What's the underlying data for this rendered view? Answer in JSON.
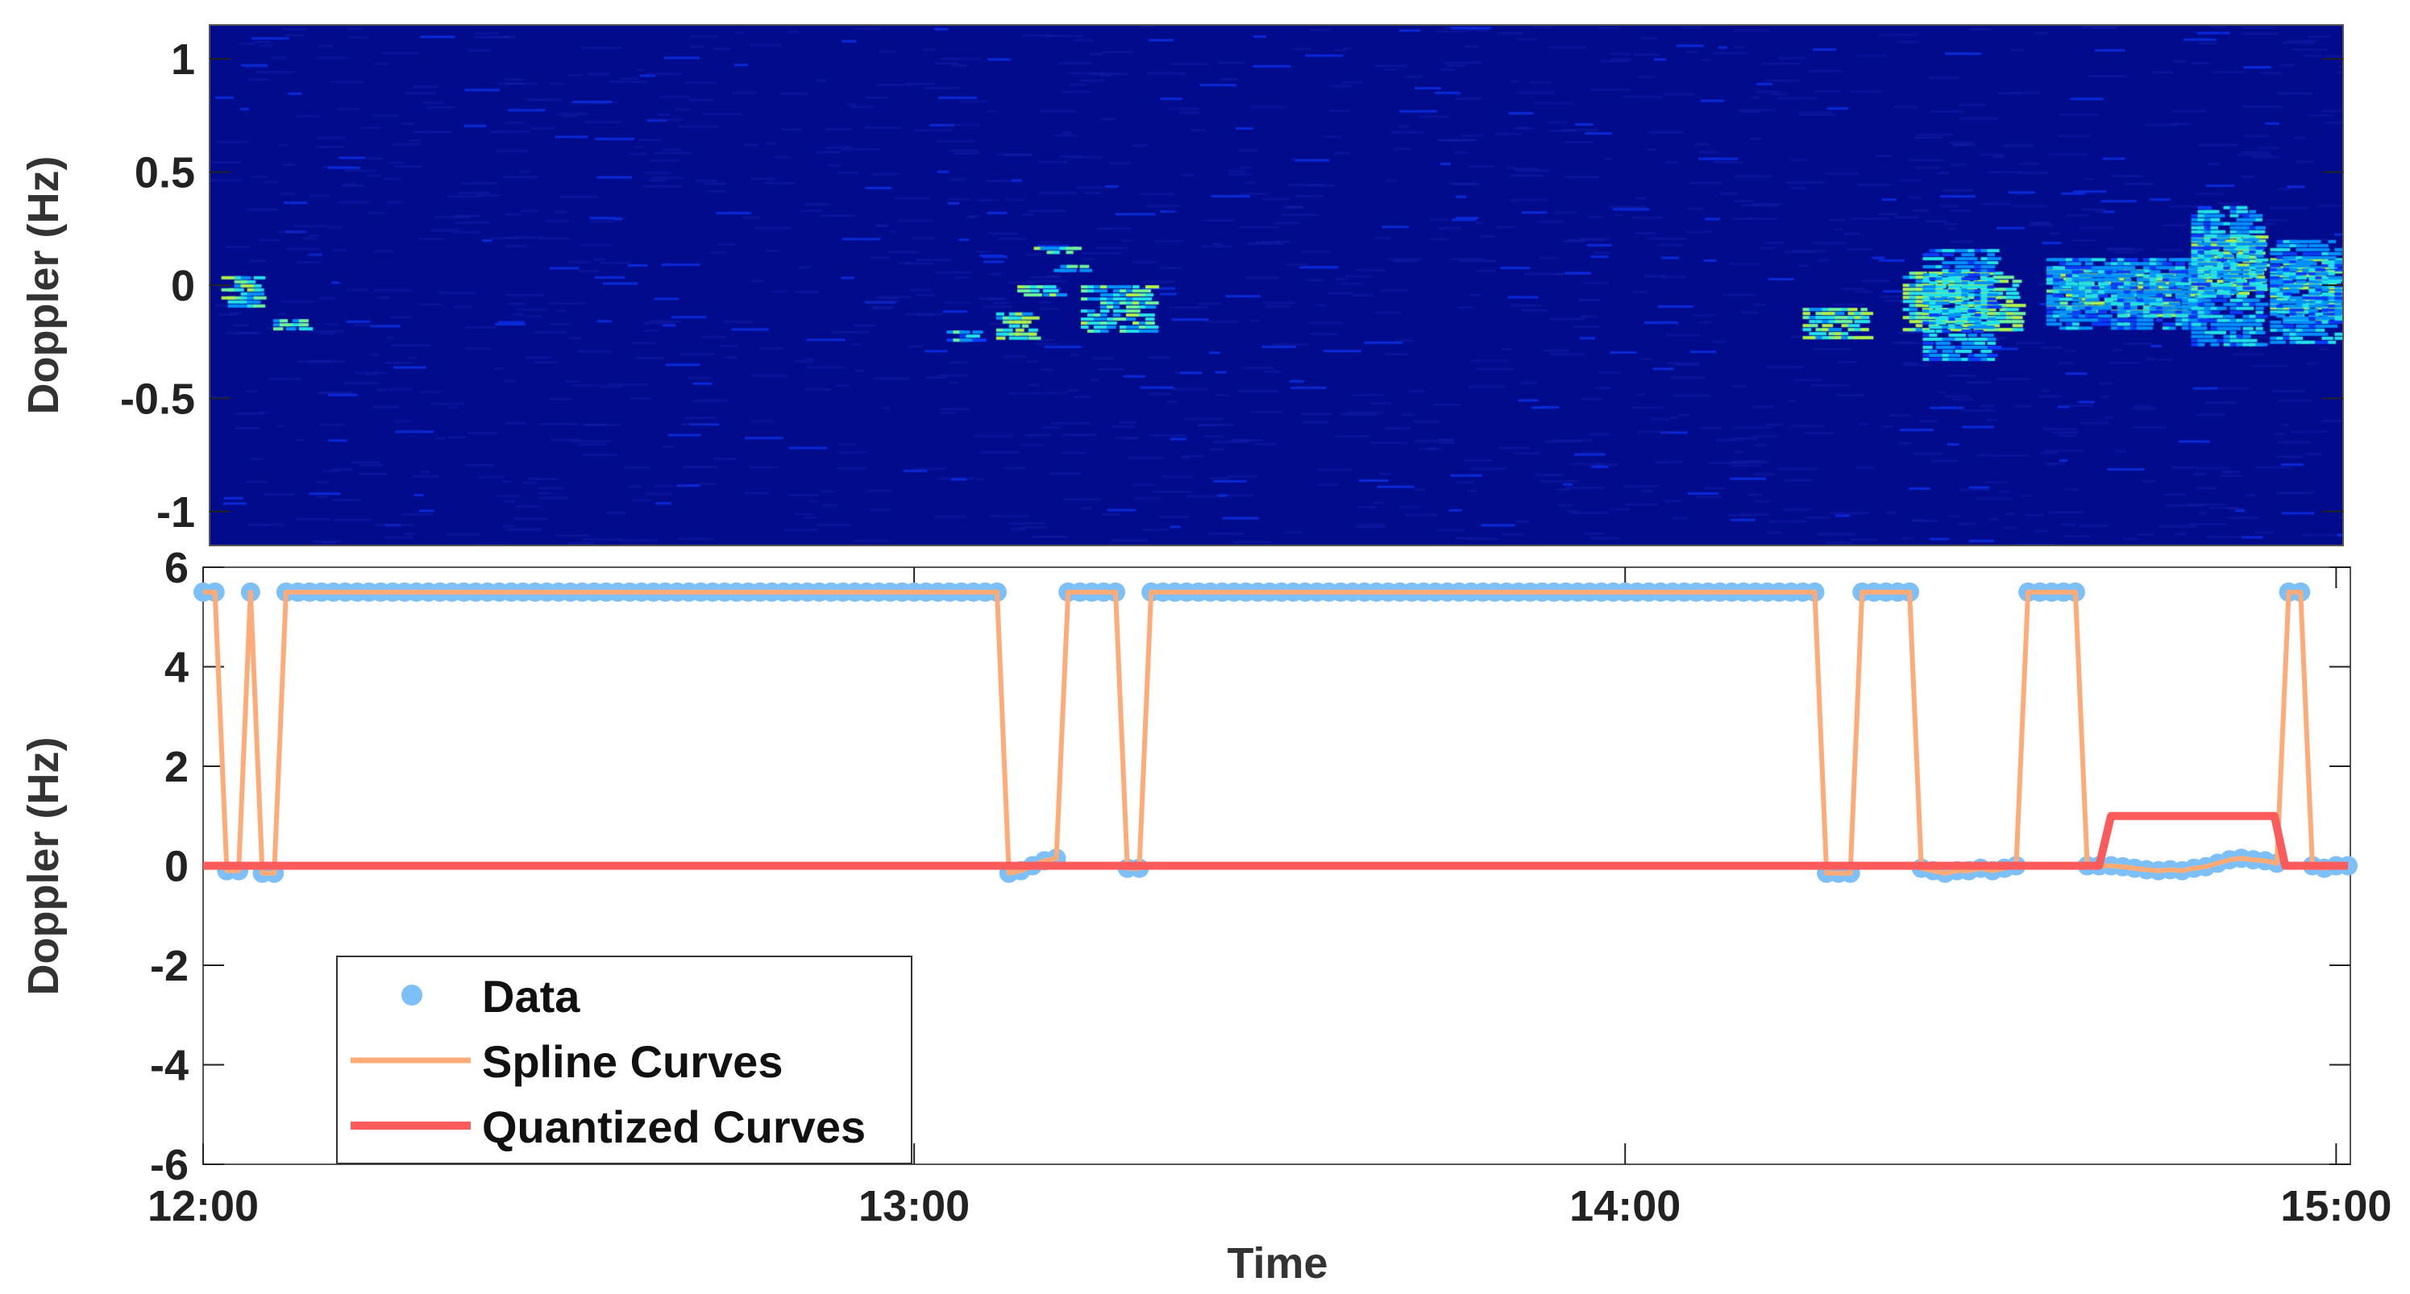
{
  "chart_data": [
    {
      "type": "heatmap",
      "title": "",
      "xlabel": "",
      "ylabel": "Doppler (Hz)",
      "xlim_minutes_after_12": [
        0,
        181.2
      ],
      "ylim": [
        -1.15,
        1.15
      ],
      "yticks": [
        1,
        0.5,
        0,
        -0.5,
        -1
      ],
      "ytick_labels": [
        "1",
        "0.5",
        "0",
        "-0.5",
        "-1"
      ],
      "colormap": "jet",
      "background_color": "#020b8c",
      "blobs": [
        {
          "t": [
            1,
            4
          ],
          "d": [
            -0.1,
            0.04
          ],
          "i": 0.75
        },
        {
          "t": [
            5.4,
            8
          ],
          "d": [
            -0.2,
            -0.15
          ],
          "i": 0.7
        },
        {
          "t": [
            62.6,
            65
          ],
          "d": [
            -0.24,
            -0.2
          ],
          "i": 0.6
        },
        {
          "t": [
            66.8,
            70
          ],
          "d": [
            -0.23,
            -0.12
          ],
          "i": 0.8
        },
        {
          "t": [
            70,
            73.3
          ],
          "d": [
            0.14,
            0.17
          ],
          "i": 0.75
        },
        {
          "t": [
            68.6,
            72
          ],
          "d": [
            -0.05,
            0.0
          ],
          "i": 0.7
        },
        {
          "t": [
            71.7,
            74
          ],
          "d": [
            0.06,
            0.09
          ],
          "i": 0.65
        },
        {
          "t": [
            74,
            79.8
          ],
          "d": [
            -0.2,
            0.0
          ],
          "i": 0.7
        },
        {
          "t": [
            135.3,
            140.5
          ],
          "d": [
            -0.24,
            -0.1
          ],
          "i": 0.8
        },
        {
          "t": [
            143.8,
            153.5
          ],
          "d": [
            -0.2,
            0.06
          ],
          "i": 0.85
        },
        {
          "t": [
            145.5,
            151
          ],
          "d": [
            -0.33,
            0.16
          ],
          "i": 0.55
        },
        {
          "t": [
            156,
            169
          ],
          "d": [
            -0.13,
            0.07
          ],
          "i": 0.8
        },
        {
          "t": [
            156,
            169
          ],
          "d": [
            -0.2,
            0.12
          ],
          "i": 0.5
        },
        {
          "t": [
            168.3,
            174.2
          ],
          "d": [
            -0.03,
            0.22
          ],
          "i": 0.85
        },
        {
          "t": [
            168.3,
            174.2
          ],
          "d": [
            -0.27,
            0.35
          ],
          "i": 0.55
        },
        {
          "t": [
            175,
            181
          ],
          "d": [
            -0.15,
            0.12
          ],
          "i": 0.75
        },
        {
          "t": [
            175,
            181
          ],
          "d": [
            -0.25,
            0.2
          ],
          "i": 0.5
        }
      ]
    },
    {
      "type": "line",
      "title": "",
      "xlabel": "Time",
      "ylabel": "Doppler (Hz)",
      "x_unit": "minutes after 12:00",
      "xlim": [
        0,
        181.2
      ],
      "ylim": [
        -6,
        6
      ],
      "xticks": [
        0,
        60,
        120,
        180
      ],
      "xtick_labels": [
        "12:00",
        "13:00",
        "14:00",
        "15:00"
      ],
      "yticks": [
        6,
        4,
        2,
        0,
        -2,
        -4,
        -6
      ],
      "ytick_labels": [
        "6",
        "4",
        "2",
        "0",
        "-2",
        "-4",
        "-6"
      ],
      "grid": false,
      "legend": {
        "placement": "bottom-left",
        "entries": [
          "Data",
          "Spline Curves",
          "Quantized Curves"
        ]
      },
      "colors": {
        "data": "#7cc0f7",
        "spline": "#ffab78",
        "quantized": "#fb5b5b"
      },
      "series": [
        {
          "name": "Data",
          "x_start": 0,
          "x_step": 1,
          "values": [
            5.5,
            5.5,
            -0.1,
            -0.1,
            5.5,
            -0.15,
            -0.15,
            5.5,
            5.5,
            5.5,
            5.5,
            5.5,
            5.5,
            5.5,
            5.5,
            5.5,
            5.5,
            5.5,
            5.5,
            5.5,
            5.5,
            5.5,
            5.5,
            5.5,
            5.5,
            5.5,
            5.5,
            5.5,
            5.5,
            5.5,
            5.5,
            5.5,
            5.5,
            5.5,
            5.5,
            5.5,
            5.5,
            5.5,
            5.5,
            5.5,
            5.5,
            5.5,
            5.5,
            5.5,
            5.5,
            5.5,
            5.5,
            5.5,
            5.5,
            5.5,
            5.5,
            5.5,
            5.5,
            5.5,
            5.5,
            5.5,
            5.5,
            5.5,
            5.5,
            5.5,
            5.5,
            5.5,
            5.5,
            5.5,
            5.5,
            5.5,
            5.5,
            5.5,
            -0.15,
            -0.1,
            0,
            0.1,
            0.15,
            5.5,
            5.5,
            5.5,
            5.5,
            5.5,
            -0.05,
            -0.05,
            5.5,
            5.5,
            5.5,
            5.5,
            5.5,
            5.5,
            5.5,
            5.5,
            5.5,
            5.5,
            5.5,
            5.5,
            5.5,
            5.5,
            5.5,
            5.5,
            5.5,
            5.5,
            5.5,
            5.5,
            5.5,
            5.5,
            5.5,
            5.5,
            5.5,
            5.5,
            5.5,
            5.5,
            5.5,
            5.5,
            5.5,
            5.5,
            5.5,
            5.5,
            5.5,
            5.5,
            5.5,
            5.5,
            5.5,
            5.5,
            5.5,
            5.5,
            5.5,
            5.5,
            5.5,
            5.5,
            5.5,
            5.5,
            5.5,
            5.5,
            5.5,
            5.5,
            5.5,
            5.5,
            5.5,
            5.5,
            5.5,
            -0.15,
            -0.15,
            -0.15,
            5.5,
            5.5,
            5.5,
            5.5,
            5.5,
            -0.05,
            -0.1,
            -0.15,
            -0.1,
            -0.1,
            -0.05,
            -0.1,
            -0.05,
            0,
            5.5,
            5.5,
            5.5,
            5.5,
            5.5,
            0,
            0,
            0,
            -0.02,
            -0.05,
            -0.08,
            -0.1,
            -0.08,
            -0.1,
            -0.05,
            -0.02,
            0.05,
            0.12,
            0.15,
            0.12,
            0.1,
            0.05,
            5.5,
            5.5,
            0,
            -0.05,
            0,
            0
          ]
        },
        {
          "name": "Spline Curves",
          "x_start": 0,
          "x_step": 1,
          "values": [
            5.5,
            5.5,
            -0.1,
            -0.1,
            5.5,
            -0.15,
            -0.15,
            5.5,
            5.5,
            5.5,
            5.5,
            5.5,
            5.5,
            5.5,
            5.5,
            5.5,
            5.5,
            5.5,
            5.5,
            5.5,
            5.5,
            5.5,
            5.5,
            5.5,
            5.5,
            5.5,
            5.5,
            5.5,
            5.5,
            5.5,
            5.5,
            5.5,
            5.5,
            5.5,
            5.5,
            5.5,
            5.5,
            5.5,
            5.5,
            5.5,
            5.5,
            5.5,
            5.5,
            5.5,
            5.5,
            5.5,
            5.5,
            5.5,
            5.5,
            5.5,
            5.5,
            5.5,
            5.5,
            5.5,
            5.5,
            5.5,
            5.5,
            5.5,
            5.5,
            5.5,
            5.5,
            5.5,
            5.5,
            5.5,
            5.5,
            5.5,
            5.5,
            5.5,
            -0.15,
            -0.1,
            0,
            0.1,
            0.15,
            5.5,
            5.5,
            5.5,
            5.5,
            5.5,
            -0.05,
            -0.05,
            5.5,
            5.5,
            5.5,
            5.5,
            5.5,
            5.5,
            5.5,
            5.5,
            5.5,
            5.5,
            5.5,
            5.5,
            5.5,
            5.5,
            5.5,
            5.5,
            5.5,
            5.5,
            5.5,
            5.5,
            5.5,
            5.5,
            5.5,
            5.5,
            5.5,
            5.5,
            5.5,
            5.5,
            5.5,
            5.5,
            5.5,
            5.5,
            5.5,
            5.5,
            5.5,
            5.5,
            5.5,
            5.5,
            5.5,
            5.5,
            5.5,
            5.5,
            5.5,
            5.5,
            5.5,
            5.5,
            5.5,
            5.5,
            5.5,
            5.5,
            5.5,
            5.5,
            5.5,
            5.5,
            5.5,
            5.5,
            5.5,
            -0.15,
            -0.15,
            -0.15,
            5.5,
            5.5,
            5.5,
            5.5,
            5.5,
            -0.05,
            -0.1,
            -0.15,
            -0.1,
            -0.1,
            -0.05,
            -0.1,
            -0.05,
            0,
            5.5,
            5.5,
            5.5,
            5.5,
            5.5,
            0,
            0,
            0,
            -0.02,
            -0.05,
            -0.08,
            -0.1,
            -0.08,
            -0.1,
            -0.05,
            -0.02,
            0.05,
            0.12,
            0.15,
            0.12,
            0.1,
            0.05,
            5.5,
            5.5,
            0,
            -0.05,
            0,
            0
          ]
        },
        {
          "name": "Quantized Curves",
          "points": [
            [
              0,
              0
            ],
            [
              160,
              0
            ],
            [
              161,
              1
            ],
            [
              174.8,
              1
            ],
            [
              175.7,
              0
            ],
            [
              181,
              0
            ]
          ]
        }
      ]
    }
  ]
}
